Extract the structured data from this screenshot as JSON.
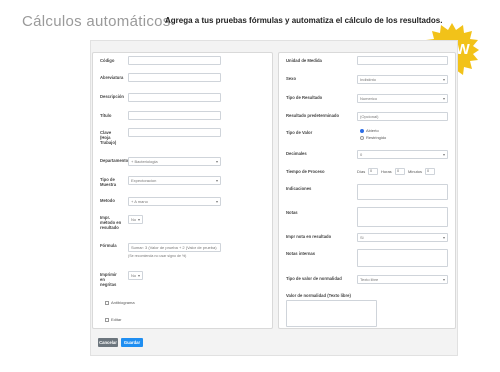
{
  "header": {
    "title": "Cálculos automáticos",
    "subtitle": "Agrega a tus pruebas fórmulas y automatiza el cálculo de los resultados.",
    "badge": "NEW"
  },
  "left": {
    "codigo_label": "Código",
    "abreviatura_label": "Abreviatura",
    "descripcion_label": "Descripción",
    "titulo_label": "Título",
    "clave_label": "Clave (Hoja Trabajo)",
    "departamento_label": "Departamento",
    "departamento_value": "Bacteriologia",
    "tipo_muestra_label": "Tipo de Muestra",
    "tipo_muestra_value": "Expectoracion",
    "metodo_label": "Metodo",
    "metodo_value": "A mano",
    "impr_label": "Impr. método en resultado",
    "impr_value": "No",
    "formula_label": "Fórmula",
    "formula_placeholder": "Sumar: 3 (Valor de prueba + 2 (Valor de prueba)",
    "formula_hint": "(Se recomienda no usar signo de %)",
    "imprimir_label": "Imprimir en negritas",
    "imprimir_value": "No",
    "antibiograma_label": "Antibiograma",
    "editar_label": "Editar"
  },
  "right": {
    "unidad_label": "Unidad de Medida",
    "sexo_label": "Sexo",
    "sexo_value": "Indistinto",
    "tipo_resultado_label": "Tipo de Resultado",
    "tipo_resultado_value": "Numerico",
    "resultado_pred_label": "Resultado predeterminado",
    "resultado_pred_placeholder": "(Opcional)",
    "tipo_valor_label": "Tipo de Valor",
    "radio_abierto": "Abierto",
    "radio_restringido": "Restringido",
    "decimales_label": "Decimales",
    "decimales_value": "0",
    "tiempo_label": "Tiempo de Proceso",
    "dias_label": "Días",
    "dias_value": "0",
    "horas_label": "Horas",
    "horas_value": "0",
    "minutos_label": "Minutos",
    "minutos_value": "0",
    "indicaciones_label": "Indicaciones",
    "notas_label": "Notas",
    "impr_nota_label": "Impr nota en resultado",
    "impr_nota_value": "Si",
    "notas_internas_label": "Notas internas",
    "tipo_normalidad_label": "Tipo de valor de normalidad",
    "tipo_normalidad_value": "Texto libre",
    "valor_normalidad_label": "Valor de normalidad (Texto libre)"
  },
  "footer": {
    "cancel_label": "Cancelar",
    "save_label": "Guardar"
  },
  "colors": {
    "badge": "#f2c219",
    "primary": "#1f8ef1",
    "secondary": "#6c757d"
  }
}
